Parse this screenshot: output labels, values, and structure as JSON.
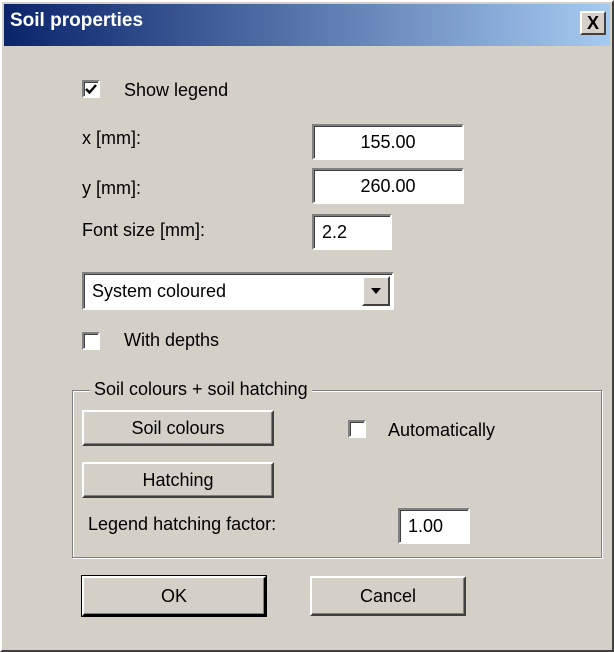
{
  "window": {
    "title": "Soil properties",
    "close_glyph": "X"
  },
  "legend": {
    "show_legend_label": "Show legend",
    "show_legend_checked": true,
    "x_label": "x [mm]:",
    "x_value": "155.00",
    "y_label": "y [mm]:",
    "y_value": "260.00",
    "font_size_label": "Font size [mm]:",
    "font_size_value": "2.2"
  },
  "style_select": {
    "selected": "System coloured"
  },
  "with_depths": {
    "label": "With depths",
    "checked": false
  },
  "soil_group": {
    "title": "Soil colours + soil hatching",
    "soil_colours_button": "Soil colours",
    "automatically_label": "Automatically",
    "automatically_checked": false,
    "hatching_button": "Hatching",
    "hatching_factor_label": "Legend hatching factor:",
    "hatching_factor_value": "1.00"
  },
  "footer": {
    "ok_label": "OK",
    "cancel_label": "Cancel"
  },
  "icons": {
    "close": "close-icon",
    "check": "checkmark-icon",
    "dropdown": "dropdown-arrow-icon"
  },
  "colors": {
    "titlebar_start": "#0a246a",
    "titlebar_end": "#a6caf0",
    "face": "#d4d0c8"
  }
}
